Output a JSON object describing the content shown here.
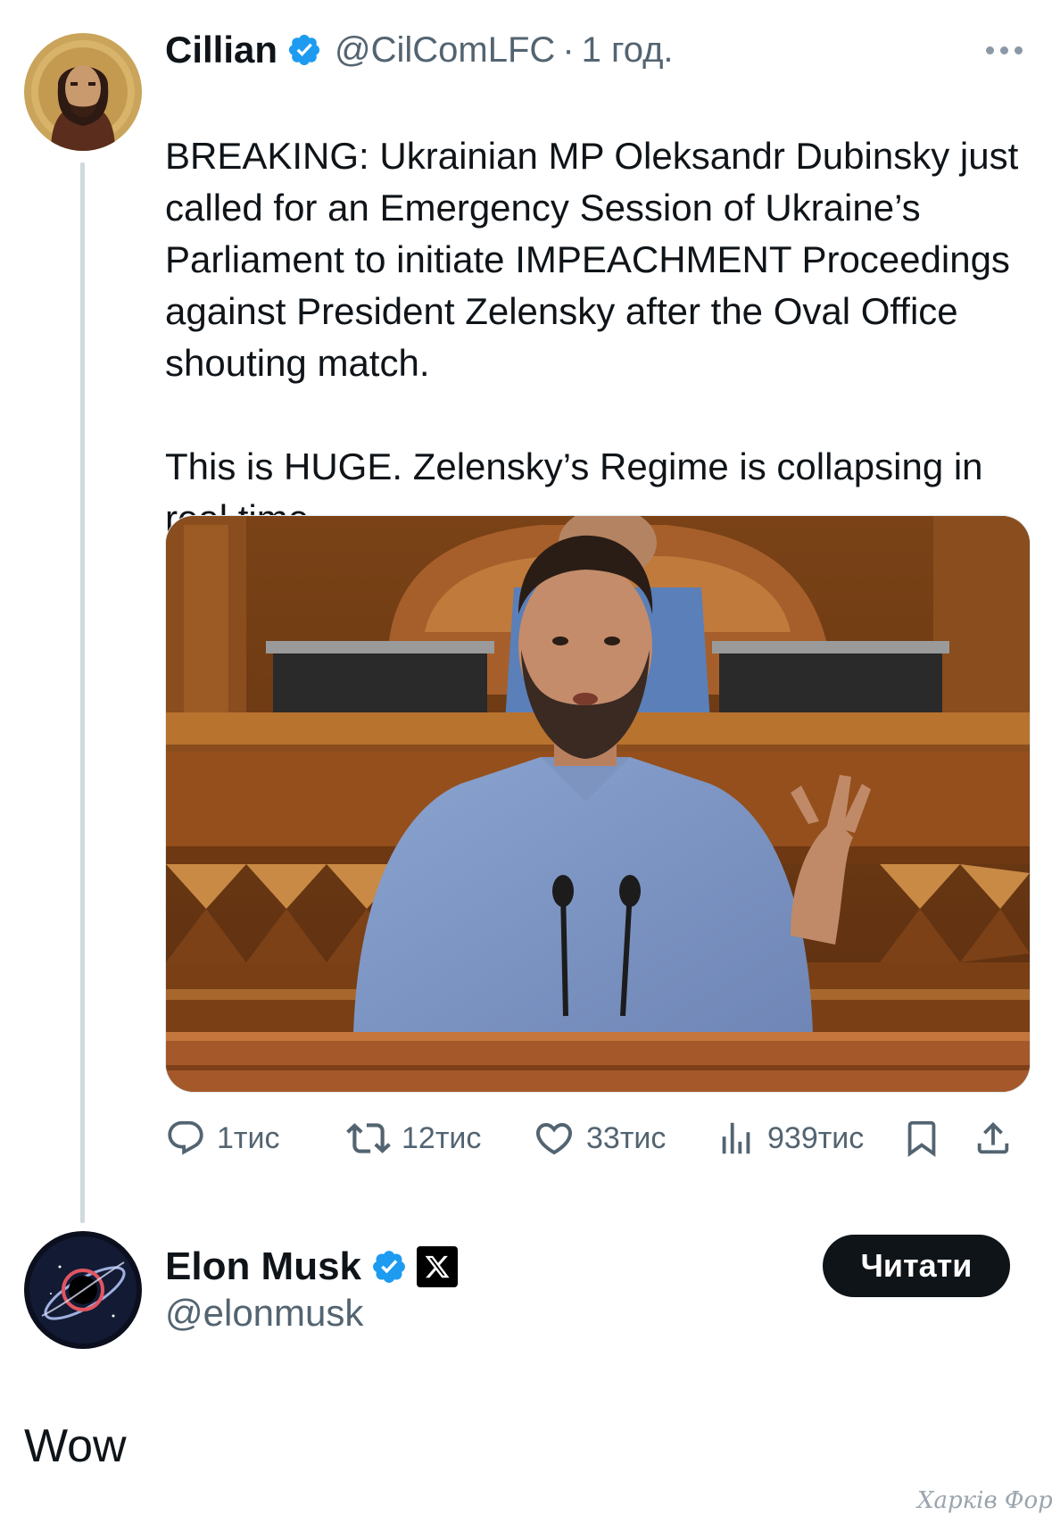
{
  "post": {
    "author": {
      "name": "Cillian",
      "handle": "@CilComLFC",
      "separator": "·",
      "time": "1 год.",
      "verified": true
    },
    "text": {
      "flag_icon": "ukraine-flag-emoji",
      "paragraph1": "BREAKING: Ukrainian MP Oleksandr Dubinsky just called for an Emergency Session of Ukraine’s Parliament to initiate IMPEACHMENT Proceedings against President Zelensky after the Oval Office shouting match.",
      "paragraph2": "This is HUGE. Zelensky’s Regime is collapsing in real time."
    },
    "stats": {
      "replies": "1тис",
      "reposts": "12тис",
      "likes": "33тис",
      "views": "939тис"
    }
  },
  "profile_card": {
    "name": "Elon Musk",
    "handle": "@elonmusk",
    "verified": true,
    "affiliate_badge_icon": "x-logo-icon",
    "follow_label": "Читати"
  },
  "reply": {
    "text": "Wow"
  },
  "watermark": "Харків Форум",
  "colors": {
    "verified_blue": "#1d9bf0",
    "secondary_text": "#536471",
    "thread_line": "#cfd9de",
    "button_dark": "#0f1419"
  }
}
